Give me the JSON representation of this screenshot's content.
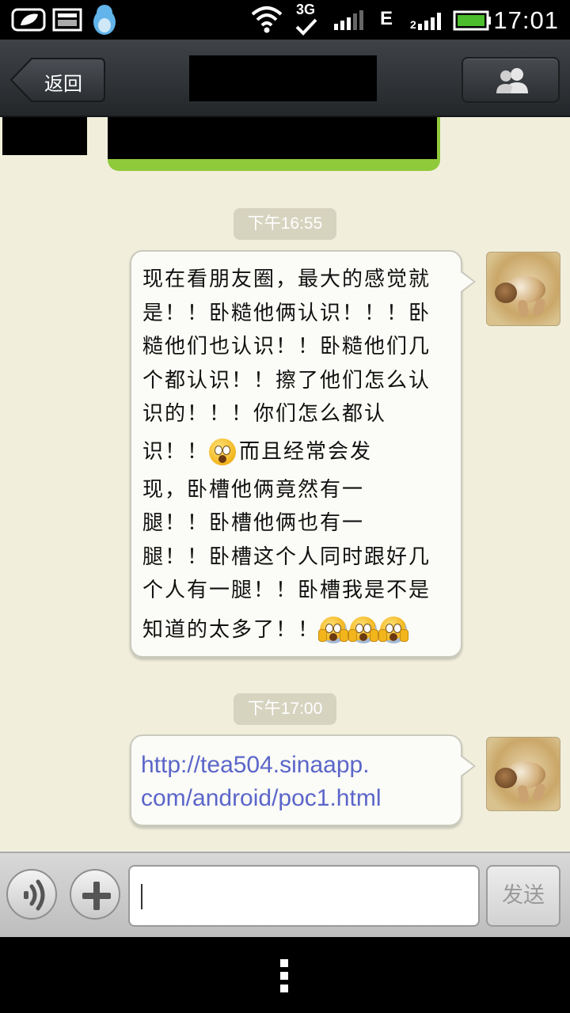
{
  "status_bar": {
    "time": "17:01",
    "network_3g": "3G",
    "network_e": "E",
    "icons": [
      "leaf-notification-icon",
      "image-notification-icon",
      "qq-penguin-icon",
      "wifi-icon",
      "3g-signal-icon",
      "signal-icon",
      "e-signal-icon",
      "battery-icon"
    ],
    "battery_color": "#4cbd2c"
  },
  "title_bar": {
    "back_label": "返回",
    "contacts_icon": "two-people-icon"
  },
  "chat": {
    "messages": [
      {
        "time": "下午16:55",
        "lines": [
          "现在看朋友圈，最大的感觉就",
          "是！！卧糙他俩认识！！！卧",
          "糙他们也认识！！卧糙他们几",
          "个都认识！！擦了他们怎么认",
          "识的！！！你们怎么都认",
          "识！！",
          "而且经常会发",
          "现，卧槽他俩竟然有一",
          "腿！！卧槽他俩也有一",
          "腿！！卧槽这个人同时跟好几",
          "个人有一腿！！卧槽我是不是",
          "知道的太多了！！"
        ],
        "emojis": [
          "surprised-face-emoji",
          "scream-face-emoji",
          "scream-face-emoji",
          "scream-face-emoji"
        ]
      },
      {
        "time": "下午17:00",
        "link_lines": [
          "http://tea504.sinaapp.",
          "com/android/poc1.html"
        ]
      }
    ],
    "bubble_accent": "#8fca3a",
    "link_color": "#5b66c9"
  },
  "input_bar": {
    "voice_icon": "voice-wave-icon",
    "plus_icon": "plus-icon",
    "send_label": "发送"
  },
  "nav_bar": {
    "menu_icon": "menu-dots-icon"
  }
}
